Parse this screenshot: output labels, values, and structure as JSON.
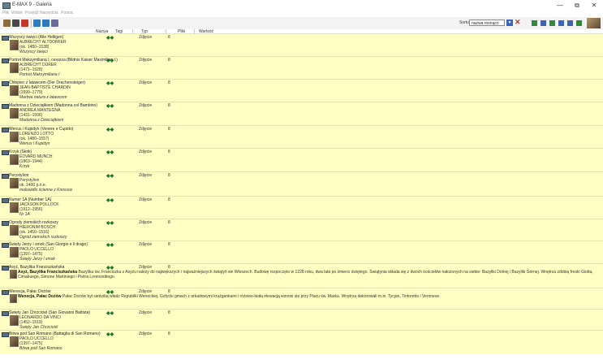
{
  "window": {
    "title": "E-MAX 9 - Galeria",
    "minimize": "—",
    "maximize": "⧉",
    "close": "✕"
  },
  "menu": [
    "Plik",
    "Widok",
    "Przejdź",
    "Narzędzia",
    "Pomoc"
  ],
  "toolbar": {
    "sort_label": "Sortuj:",
    "sort_value": "nazwa rosnąco",
    "sort_arrow": "▼",
    "clear": "✕"
  },
  "columns": {
    "name": "Nazwa",
    "tags": "Tagi",
    "type": "Typ",
    "count": "Pliki",
    "extra": "Wartość"
  },
  "colors": {
    "row_bg": "#ffffc4",
    "tag_green": "#1d7a2a",
    "accent_blue": "#3c63b5"
  },
  "records": [
    {
      "title": "Wszyscy święci (Alle Helligen)",
      "tags": "◆◆",
      "type": "Zdjęcie",
      "count": "8",
      "lines": [
        "ALBRECHT ALTDORFER",
        "(ok. 1480–1538)",
        "Wszyscy święci"
      ]
    },
    {
      "title": "Portret Maksymiliana I, cesarza (Bildnis Kaiser Maximilian I.)",
      "tags": "◆◆",
      "type": "Zdjęcie",
      "count": "8",
      "lines": [
        "ALBRECHT DÜRER",
        "(1471–1528)",
        "Portret Maksymiliana I"
      ]
    },
    {
      "title": "Chłopiec z latawcem (Der Drachensteiger)",
      "tags": "◆◆",
      "type": "Zdjęcie",
      "count": "8",
      "lines": [
        "JEAN-BAPTISTE CHARDIN",
        "(1699–1779)",
        "Martwa natura z latawcem"
      ]
    },
    {
      "title": "Madonna z Dzieciątkiem (Madonna col Bambino)",
      "tags": "◆◆",
      "type": "Zdjęcie",
      "count": "8",
      "lines": [
        "ANDREA MANTEGNA",
        "(1431–1506)",
        "Madonna z Dzieciątkiem"
      ]
    },
    {
      "title": "Wenus i Kupidyn (Venere e Cupido)",
      "tags": "◆◆",
      "type": "Zdjęcie",
      "count": "8",
      "lines": [
        "LORENZO LOTTO",
        "(ok. 1480–1557)",
        "Wenus i Kupidyn"
      ]
    },
    {
      "title": "Krzyk (Skrik)",
      "tags": "◆◆",
      "type": "Zdjęcie",
      "count": "8",
      "lines": [
        "EDVARD MUNCH",
        "(1863–1944)",
        "Krzyk"
      ]
    },
    {
      "title": "Perystylion",
      "tags": "◆◆",
      "type": "Zdjęcie",
      "count": "8",
      "lines": [
        "Perystylion",
        "ok. 1400 p.n.e.",
        "malowidło ścienne z Knossos"
      ]
    },
    {
      "title": "Numer 1A (Number 1A)",
      "tags": "◆◆",
      "type": "Zdjęcie",
      "count": "8",
      "lines": [
        "JACKSON POLLOCK",
        "(1912–1956)",
        "Nr 1A"
      ]
    },
    {
      "title": "Ogrody ziemskich rozkoszy",
      "tags": "◆◆",
      "type": "Zdjęcie",
      "count": "8",
      "lines": [
        "HIERONIM BOSCH",
        "(ok. 1450–1516)",
        "Ogród ziemskich rozkoszy"
      ]
    },
    {
      "title": "Święty Jerzy i smok (San Giorgio e il drago)",
      "tags": "◆◆",
      "type": "Zdjęcie",
      "count": "8",
      "lines": [
        "PAOLO UCCELLO",
        "(1397–1475)",
        "Święty Jerzy i smok"
      ]
    },
    {
      "title": "Asyż, Bazylika Franciszkańska",
      "tags": "◆◆",
      "type": "Zdjęcie",
      "count": "8",
      "desc_bold": "Asyż, Bazylika Franciszkańska",
      "desc": "Bazylika św. Franciszka z Asyżu należy do największych i najważniejszych świątyń we Włoszech. Budowę rozpoczęto w 1228 roku, dwa lata po śmierci świętego. Świątynia składa się z dwóch kościołów nałożonych na siebie: Bazyliki Dolnej i Bazyliki Górnej. Wnętrza zdobią freski Giotta, Cimabuego, Simone Martiniego i Pietra Lorenzettiego."
    },
    {
      "title": "Wenecja, Pałac Dożów",
      "tags": "◆◆",
      "type": "Zdjęcie",
      "count": "8",
      "desc_bold": "Wenecja, Pałac Dożów",
      "desc": "Pałac Dożów był siedzibą władz Republiki Weneckiej. Gotycki gmach z arkadowymi krużgankami i różowo-białą elewacją wznosi się przy Placu św. Marka. Wnętrza dekorowali m.in. Tycjan, Tintoretto i Veronese."
    },
    {
      "title": "Święty Jan Chrzciciel (San Giovanni Battista)",
      "tags": "◆◆",
      "type": "Zdjęcie",
      "count": "8",
      "lines": [
        "LEONARDO DA VINCI",
        "(1452–1519)",
        "Święty Jan Chrzciciel"
      ]
    },
    {
      "title": "Bitwa pod San Romano (Battaglia di San Romano)",
      "tags": "◆◆",
      "type": "Zdjęcie",
      "count": "8",
      "lines": [
        "PAOLO UCCELLO",
        "(1397–1475)",
        "Bitwa pod San Romano"
      ]
    }
  ]
}
